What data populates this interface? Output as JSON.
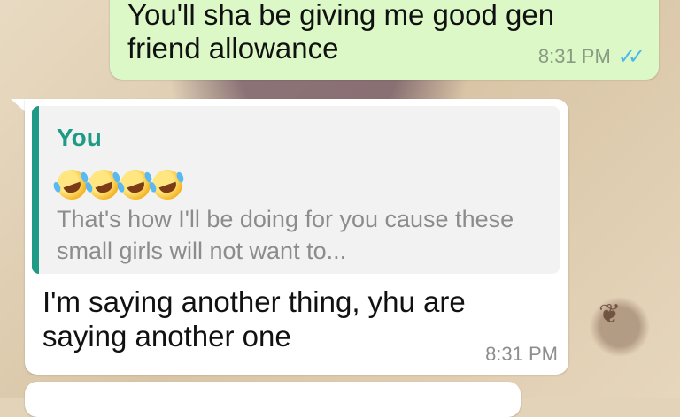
{
  "messages": {
    "outgoing": {
      "text": "You'll sha be giving me good gen friend allowance",
      "time": "8:31 PM",
      "status_icon": "double-check-read-icon",
      "status_color": "#4fb6ec"
    },
    "incoming": {
      "quoted": {
        "author": "You",
        "emojis": [
          "rolling-on-floor-laughing-emoji",
          "rolling-on-floor-laughing-emoji",
          "rolling-on-floor-laughing-emoji",
          "rolling-on-floor-laughing-emoji"
        ],
        "text": "That's how I'll be doing for you cause these small girls will not want to..."
      },
      "text": "I'm saying another thing, yhu are saying another one",
      "time": "8:31 PM"
    }
  },
  "colors": {
    "outgoing_bubble": "#dcf8c6",
    "incoming_bubble": "#ffffff",
    "quote_accent": "#1e9a86"
  }
}
